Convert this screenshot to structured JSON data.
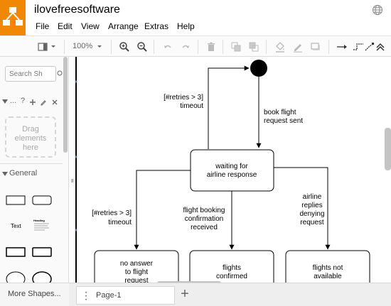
{
  "app": {
    "title": "ilovefreesoftware"
  },
  "menu": [
    "File",
    "Edit",
    "View",
    "Arrange",
    "Extras",
    "Help"
  ],
  "toolbar": {
    "zoom": "100%"
  },
  "sidebar": {
    "search_placeholder": "Search Sh",
    "scratchpad_label": "...",
    "scratchpad_help": "?",
    "drag_text_1": "Drag",
    "drag_text_2": "elements",
    "drag_text_3": "here",
    "general_label": "General",
    "text_shape_label": "Text",
    "heading_shape_label": "Heading"
  },
  "diagram": {
    "retries_1": "[#retries > 3]",
    "timeout_1": "timeout",
    "book_flight": "book flight",
    "request_sent": "request sent",
    "waiting_1": "waiting for",
    "waiting_2": "airline response",
    "retries_2": "[#retries > 3]",
    "timeout_2": "timeout",
    "fb_1": "flight booking",
    "fb_2": "confirmation",
    "fb_3": "received",
    "ar_1": "airline",
    "ar_2": "replies",
    "ar_3": "denying",
    "ar_4": "request",
    "na_1": "no answer",
    "na_2": "to flight",
    "na_3": "request",
    "fc_1": "flights",
    "fc_2": "confirmed",
    "fn_1": "flights not",
    "fn_2": "available"
  },
  "bottom": {
    "more_shapes": "More Shapes...",
    "page_menu": "⋮",
    "page_label": "Page-1",
    "add_page": "+"
  },
  "colors": {
    "logo": "#f08705"
  }
}
